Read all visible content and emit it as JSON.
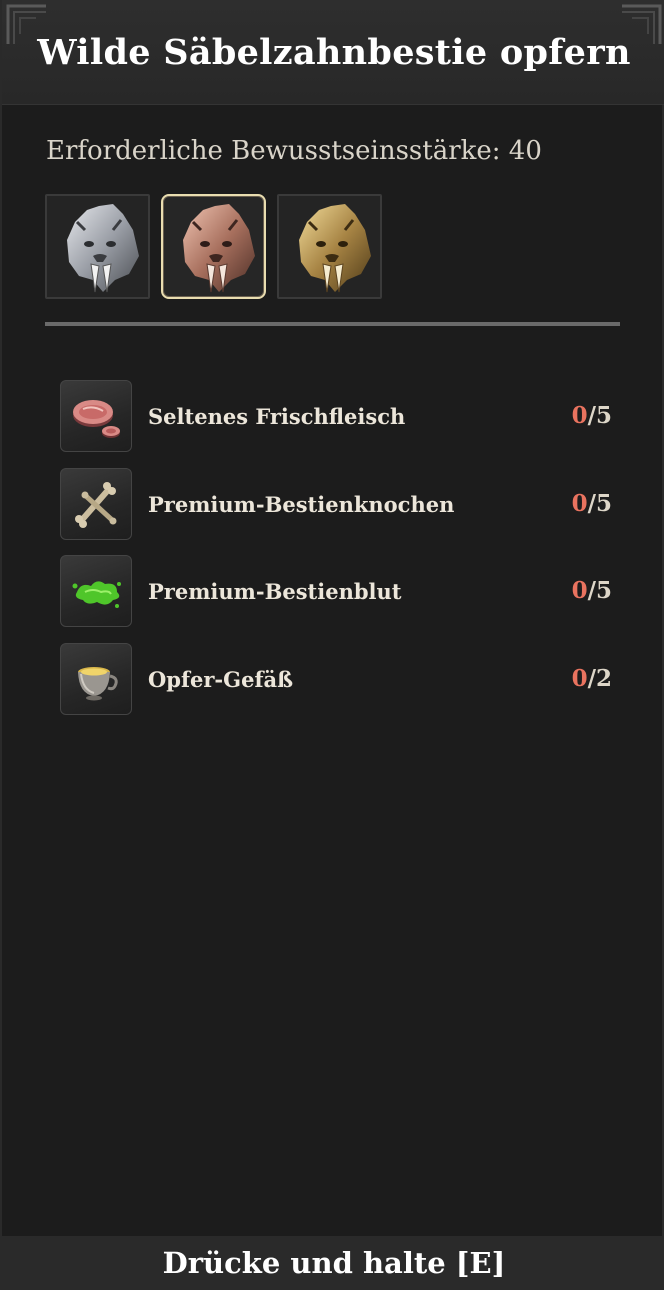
{
  "header": {
    "title": "Wilde Säbelzahnbestie opfern"
  },
  "requirement": {
    "text": "Erforderliche Bewusstseinsstärke: 40"
  },
  "tiers": [
    {
      "icon": "silver-sabertooth-head-icon",
      "color": "#b8bcc4",
      "selected": false
    },
    {
      "icon": "bronze-sabertooth-head-icon",
      "color": "#b98876",
      "selected": true
    },
    {
      "icon": "gold-sabertooth-head-icon",
      "color": "#b59a5a",
      "selected": false
    }
  ],
  "materials": [
    {
      "name": "Seltenes Frischfleisch",
      "have": "0",
      "need": "/5",
      "icon": "raw-meat-icon"
    },
    {
      "name": "Premium-Bestienknochen",
      "have": "0",
      "need": "/5",
      "icon": "bone-icon"
    },
    {
      "name": "Premium-Bestienblut",
      "have": "0",
      "need": "/5",
      "icon": "green-blood-icon"
    },
    {
      "name": "Opfer-Gefäß",
      "have": "0",
      "need": "/2",
      "icon": "golden-cup-icon"
    }
  ],
  "footer": {
    "prompt": "Drücke und halte [E]"
  },
  "colors": {
    "count_have": "#e9735f",
    "selected_border": "#e9ddb0"
  }
}
